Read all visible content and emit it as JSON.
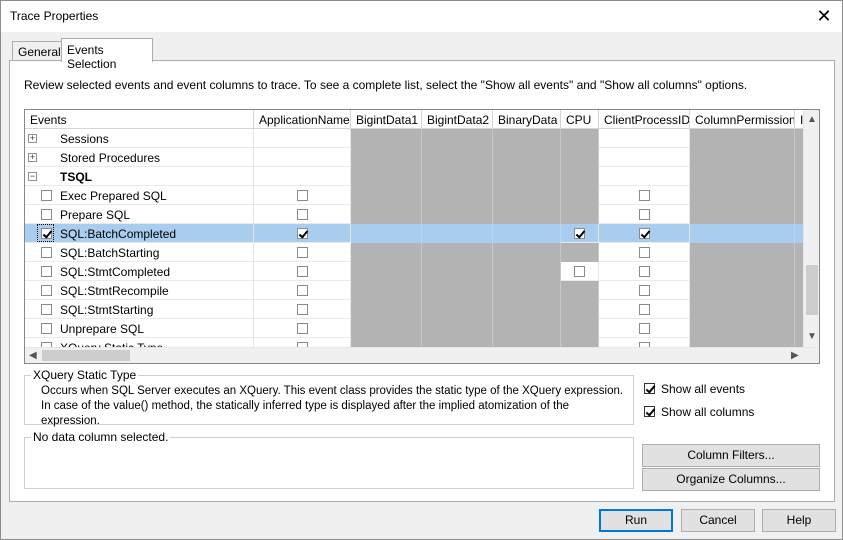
{
  "window": {
    "title": "Trace Properties",
    "close_glyph": "✕"
  },
  "tabs": [
    {
      "label": "General"
    },
    {
      "label": "Events Selection"
    }
  ],
  "info_text": "Review selected events and event columns to trace. To see a complete list, select the \"Show all events\" and \"Show all columns\" options.",
  "grid": {
    "columns": [
      "Events",
      "ApplicationName",
      "BigintData1",
      "BigintData2",
      "BinaryData",
      "CPU",
      "ClientProcessID",
      "ColumnPermissions",
      "I"
    ],
    "rows": [
      {
        "label": "Sessions",
        "type": "category",
        "expander": "+"
      },
      {
        "label": "Stored Procedures",
        "type": "category",
        "expander": "+"
      },
      {
        "label": "TSQL",
        "type": "category-open",
        "expander": "−"
      },
      {
        "label": "Exec Prepared SQL",
        "type": "event",
        "checked": false,
        "app": false,
        "cpu": null,
        "cpid": false
      },
      {
        "label": "Prepare SQL",
        "type": "event",
        "checked": false,
        "app": false,
        "cpu": null,
        "cpid": false
      },
      {
        "label": "SQL:BatchCompleted",
        "type": "event",
        "checked": true,
        "app": true,
        "cpu": true,
        "cpid": true,
        "selected": true
      },
      {
        "label": "SQL:BatchStarting",
        "type": "event",
        "checked": false,
        "app": false,
        "cpu": null,
        "cpid": false
      },
      {
        "label": "SQL:StmtCompleted",
        "type": "event",
        "checked": false,
        "app": false,
        "cpu": false,
        "cpid": false
      },
      {
        "label": "SQL:StmtRecompile",
        "type": "event",
        "checked": false,
        "app": false,
        "cpu": null,
        "cpid": false
      },
      {
        "label": "SQL:StmtStarting",
        "type": "event",
        "checked": false,
        "app": false,
        "cpu": null,
        "cpid": false
      },
      {
        "label": "Unprepare SQL",
        "type": "event",
        "checked": false,
        "app": false,
        "cpu": null,
        "cpid": false
      },
      {
        "label": "XQuery Static Type",
        "type": "event",
        "checked": false,
        "app": false,
        "cpu": null,
        "cpid": false
      }
    ],
    "scroll_glyphs": {
      "up": "▲",
      "down": "▼",
      "left": "◀",
      "right": "▶"
    }
  },
  "description": {
    "title": "XQuery Static Type",
    "text": "Occurs when SQL Server executes an XQuery. This event class provides the static type of the XQuery expression. In case of the value() method, the statically inferred type is displayed after the implied atomization of the expression."
  },
  "data_column": {
    "text": "No data column selected."
  },
  "options": {
    "show_all_events": {
      "label": "Show all events",
      "checked": true
    },
    "show_all_columns": {
      "label": "Show all columns",
      "checked": true
    }
  },
  "buttons": {
    "column_filters": "Column Filters...",
    "organize_columns": "Organize Columns...",
    "run": "Run",
    "cancel": "Cancel",
    "help": "Help"
  }
}
